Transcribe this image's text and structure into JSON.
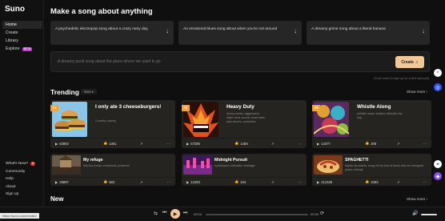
{
  "app": {
    "logo": "Suno"
  },
  "sidebar": {
    "items": [
      {
        "label": "Home",
        "active": true
      },
      {
        "label": "Create"
      },
      {
        "label": "Library"
      },
      {
        "label": "Explore",
        "badge": "BETA"
      }
    ],
    "bottom": [
      {
        "label": "What's New?",
        "badge": "5"
      },
      {
        "label": "Community"
      },
      {
        "label": "Help"
      },
      {
        "label": "About"
      },
      {
        "label": "Sign up"
      }
    ]
  },
  "header": {
    "title": "Make a song about anything"
  },
  "prompts": [
    "A psychedelic electropop song about a crazy rainy day",
    "An emotional blues song about when you're not around",
    "A dreamy grime song about a literal banana"
  ],
  "create": {
    "placeholder": "A dreamy punk song about the place where we used to go",
    "button": "Create",
    "hint": "(You'll need to sign up for a free account)"
  },
  "trending": {
    "title": "Trending",
    "filter": "Now",
    "show_more": "Show more",
    "cards": [
      {
        "rank": "#1",
        "title": "I only ate 3 cheeseburgers!",
        "tags": "Country, catchy",
        "plays": "63902",
        "likes": "1391"
      },
      {
        "rank": "#2",
        "title": "Heavy Duty",
        "tags": "heavy metal, aggressive, male clear sound, beat bass, epic drums, orchestra",
        "plays": "67280",
        "likes": "1469"
      },
      {
        "rank": "#3",
        "title": "Whistle Along",
        "tags": "whistle music footbox Melodic hip-hop",
        "plays": "14377",
        "likes": "309"
      },
      {
        "title": "My refuge",
        "tags": "folk fox-metal, emotional, powerful",
        "plays": "28897",
        "likes": "583"
      },
      {
        "title": "Midnight Pursuit",
        "tags": "synthwave cinematic nostalgic",
        "plays": "12483",
        "likes": "344"
      },
      {
        "title": "SPAGHETTI",
        "tags": "Italian tarantella, song of the lots of times and an energetic piano melody",
        "plays": "214169",
        "likes": "3493"
      }
    ]
  },
  "new_section": {
    "title": "New",
    "show_more": "Show more"
  },
  "player": {
    "current": "00:00",
    "total": "00:00",
    "progress": 0,
    "volume": 1
  },
  "status_url": "https://suno.com/create/",
  "colors": {
    "accent": "#f2c89b",
    "rank": "#f2a13c",
    "beta": "#c93cd8"
  }
}
